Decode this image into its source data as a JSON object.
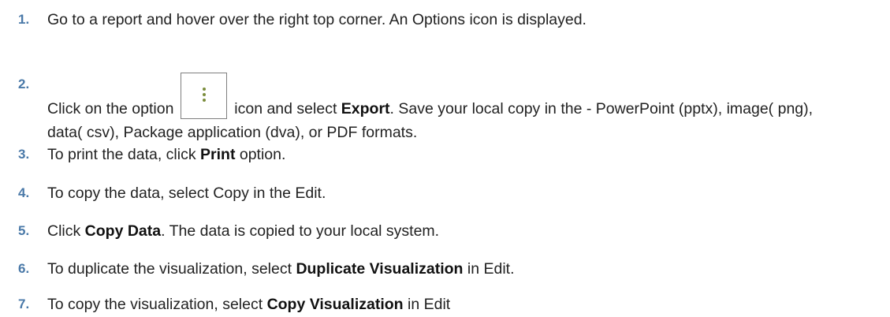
{
  "steps": [
    {
      "number": "1.",
      "parts": [
        {
          "text": "Go to a report and hover over the right top corner. An Options icon is displayed."
        }
      ]
    },
    {
      "number": "2.",
      "parts": [
        {
          "text": "Click on the option "
        },
        {
          "text": " icon and select "
        },
        {
          "text": "Export",
          "bold": true
        },
        {
          "text": ". Save your local copy in the - PowerPoint (pptx), image( png), data( csv), Package application (dva), or PDF formats."
        }
      ],
      "icon": "vertical-ellipsis-options-icon"
    },
    {
      "number": "3.",
      "parts": [
        {
          "text": "To print the data, click "
        },
        {
          "text": "Print",
          "bold": true
        },
        {
          "text": " option."
        }
      ]
    },
    {
      "number": "4.",
      "parts": [
        {
          "text": "To copy the data, select Copy in the Edit."
        }
      ]
    },
    {
      "number": "5.",
      "parts": [
        {
          "text": "Click "
        },
        {
          "text": "Copy Data",
          "bold": true
        },
        {
          "text": ". The data is copied to your local system."
        }
      ]
    },
    {
      "number": "6.",
      "parts": [
        {
          "text": "To duplicate the visualization, select "
        },
        {
          "text": "Duplicate Visualization",
          "bold": true
        },
        {
          "text": " in Edit."
        }
      ]
    },
    {
      "number": "7.",
      "parts": [
        {
          "text": "To copy the visualization, select "
        },
        {
          "text": "Copy Visualization",
          "bold": true
        },
        {
          "text": " in Edit"
        }
      ]
    }
  ],
  "colors": {
    "step_number": "#4a79a8",
    "text": "#222222",
    "icon_dots": "#7a8c3c",
    "icon_border": "#7f7f7f"
  }
}
